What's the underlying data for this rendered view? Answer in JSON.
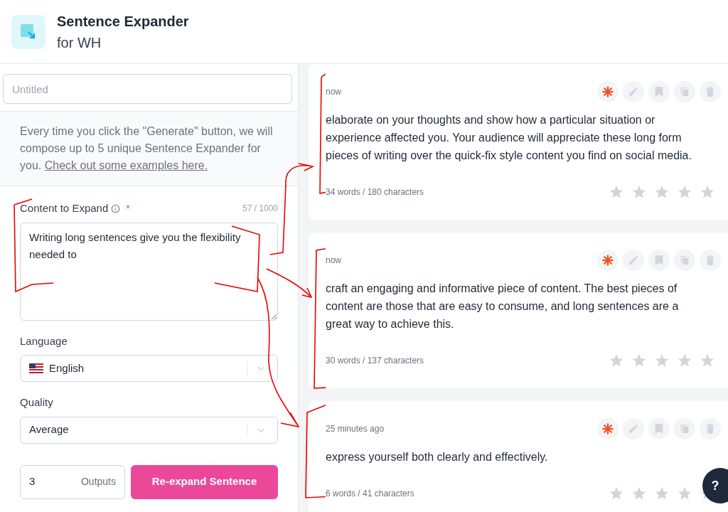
{
  "app": {
    "title": "Sentence Expander",
    "subtitle": "for WH"
  },
  "form": {
    "title_field": {
      "placeholder": "Untitled"
    },
    "info": {
      "text": "Every time you click the \"Generate\" button, we will compose up to 5 unique Sentence Expander for you.",
      "link": "Check out some examples here."
    },
    "content": {
      "label": "Content to Expand",
      "required_mark": "*",
      "counter": "57 / 1000",
      "value": "Writing long sentences give you the flexibility needed to"
    },
    "language": {
      "label": "Language",
      "value": "English"
    },
    "quality": {
      "label": "Quality",
      "value": "Average"
    },
    "outputs": {
      "value": "3",
      "label": "Outputs"
    },
    "submit": "Re-expand Sentence"
  },
  "results": [
    {
      "time": "now",
      "text": "elaborate on your thoughts and show how a particular situation or experience affected you. Your audience will appreciate these long form pieces of writing over the quick-fix style content you find on social media.",
      "stats": "34 words / 180 characters",
      "stars": 0
    },
    {
      "time": "now",
      "text": "craft an engaging and informative piece of content. The best pieces of content are those that are easy to consume, and long sentences are a great way to achieve this.",
      "stats": "30 words / 137 characters",
      "stars": 0
    },
    {
      "time": "25 minutes ago",
      "text": "express yourself both clearly and effectively.",
      "stats": "6 words / 41 characters",
      "stars": 0
    }
  ],
  "help": "?"
}
